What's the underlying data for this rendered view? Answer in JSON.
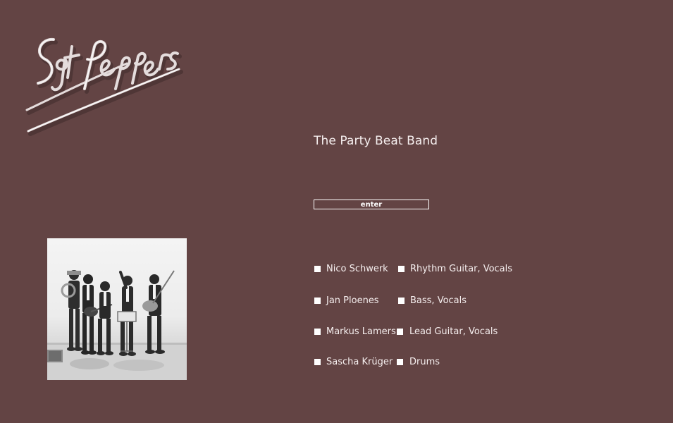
{
  "logo": {
    "text": "Sgt. Peppers",
    "icon": "sgt-peppers-logo"
  },
  "tagline": "The Party Beat Band",
  "enter_button": {
    "label": "enter"
  },
  "photo": {
    "icon": "band-photo"
  },
  "members": [
    {
      "name": "Nico Schwerk",
      "role": "Rhythm Guitar, Vocals"
    },
    {
      "name": "Jan Ploenes",
      "role": "Bass, Vocals"
    },
    {
      "name": "Markus Lamers",
      "role": "Lead Guitar, Vocals"
    },
    {
      "name": "Sascha Krüger",
      "role": "Drums"
    }
  ],
  "colors": {
    "background": "#634444",
    "text": "#f5eeee",
    "accent": "#ffffff"
  }
}
